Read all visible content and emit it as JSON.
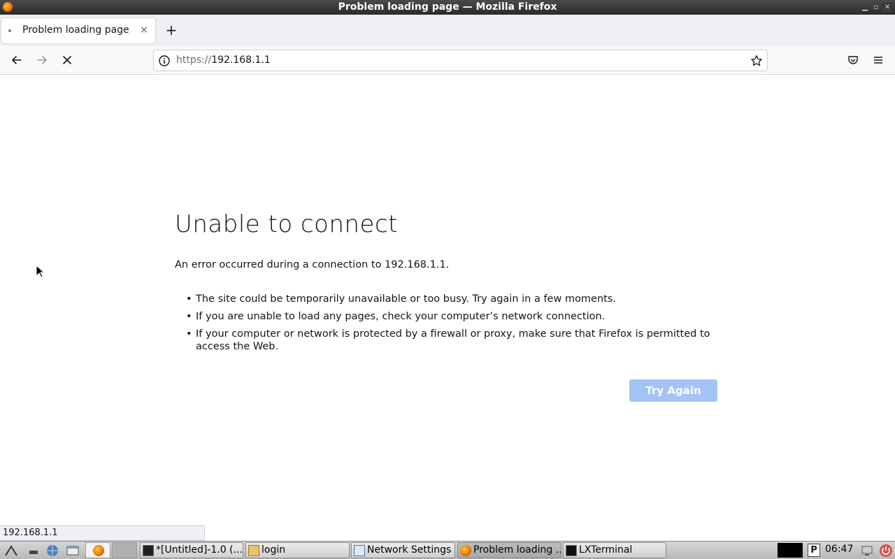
{
  "window": {
    "title": "Problem loading page — Mozilla Firefox"
  },
  "tab": {
    "title": "Problem loading page",
    "close_glyph": "×"
  },
  "toolbar": {
    "newtab_glyph": "+"
  },
  "urlbar": {
    "scheme": "https://",
    "host": "192.168.1.1"
  },
  "error": {
    "title": "Unable to connect",
    "description": "An error occurred during a connection to 192.168.1.1.",
    "bullets": [
      "The site could be temporarily unavailable or too busy. Try again in a few moments.",
      "If you are unable to load any pages, check your computer’s network connection.",
      "If your computer or network is protected by a firewall or proxy, make sure that Firefox is permitted to access the Web."
    ],
    "try_again_label": "Try Again"
  },
  "statusbar": {
    "text": "192.168.1.1"
  },
  "taskbar": {
    "tasks": [
      {
        "label": "*[Untitled]-1.0 (...",
        "icon": "image-editor-icon"
      },
      {
        "label": "login",
        "icon": "folder-icon"
      },
      {
        "label": "Network Settings",
        "icon": "window-icon"
      },
      {
        "label": "Problem loading ...",
        "icon": "firefox-icon"
      },
      {
        "label": "LXTerminal",
        "icon": "terminal-icon"
      }
    ],
    "clock": "06:47"
  },
  "colors": {
    "try_again_bg": "#a3c4f5",
    "tab_strip_bg": "#f0f0f4"
  }
}
